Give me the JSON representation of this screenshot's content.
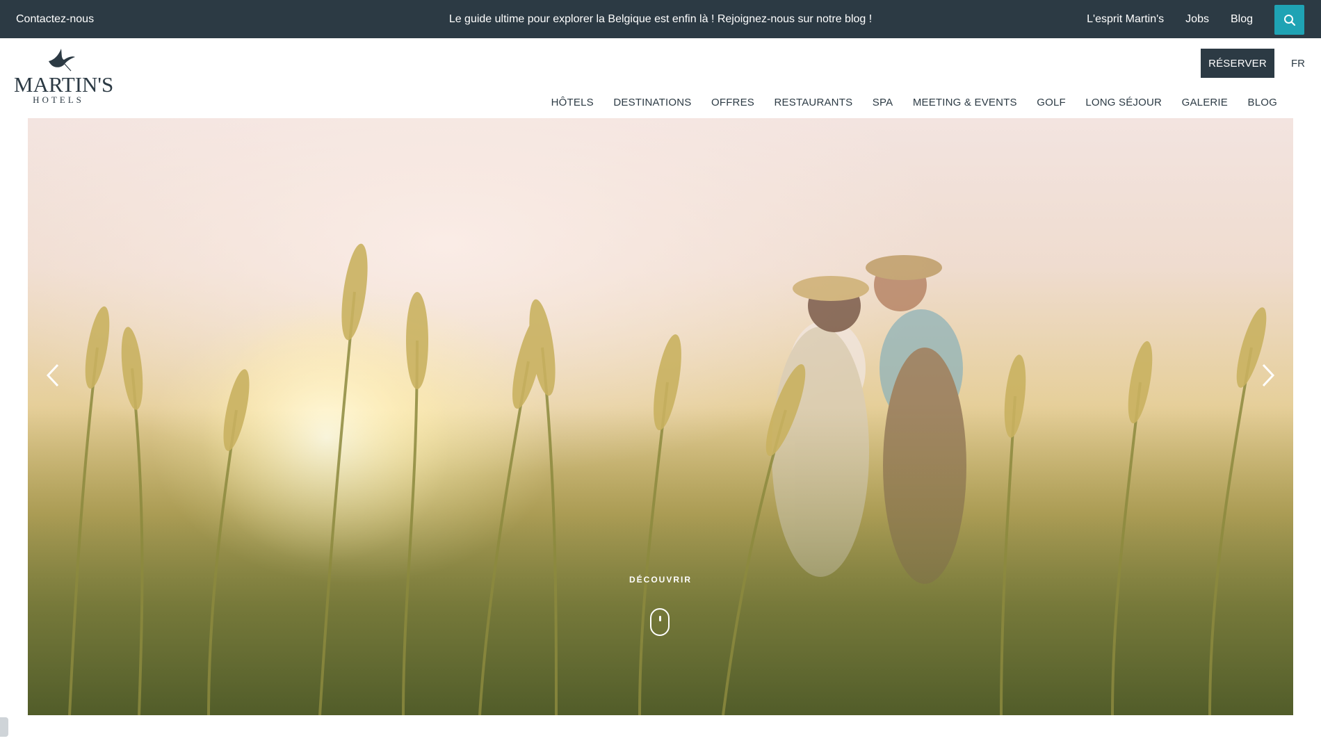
{
  "topbar": {
    "contact": "Contactez-nous",
    "announcement": "Le guide ultime pour explorer la Belgique est enfin là ! Rejoignez-nous sur notre blog !",
    "links": [
      "L'esprit Martin's",
      "Jobs",
      "Blog"
    ],
    "search_icon": "search-icon",
    "accent_color": "#1fa3b4",
    "background": "#2c3a44"
  },
  "header": {
    "logo_main": "MARTIN'S",
    "logo_sub": "HOTELS",
    "reserve_label": "RÉSERVER",
    "language": "FR",
    "nav": [
      "HÔTELS",
      "DESTINATIONS",
      "OFFRES",
      "RESTAURANTS",
      "SPA",
      "MEETING & EVENTS",
      "GOLF",
      "LONG SÉJOUR",
      "GALERIE",
      "BLOG"
    ]
  },
  "hero": {
    "discover_label": "DÉCOUVRIR",
    "prev_icon": "chevron-left-icon",
    "next_icon": "chevron-right-icon",
    "scroll_icon": "mouse-scroll-icon"
  }
}
